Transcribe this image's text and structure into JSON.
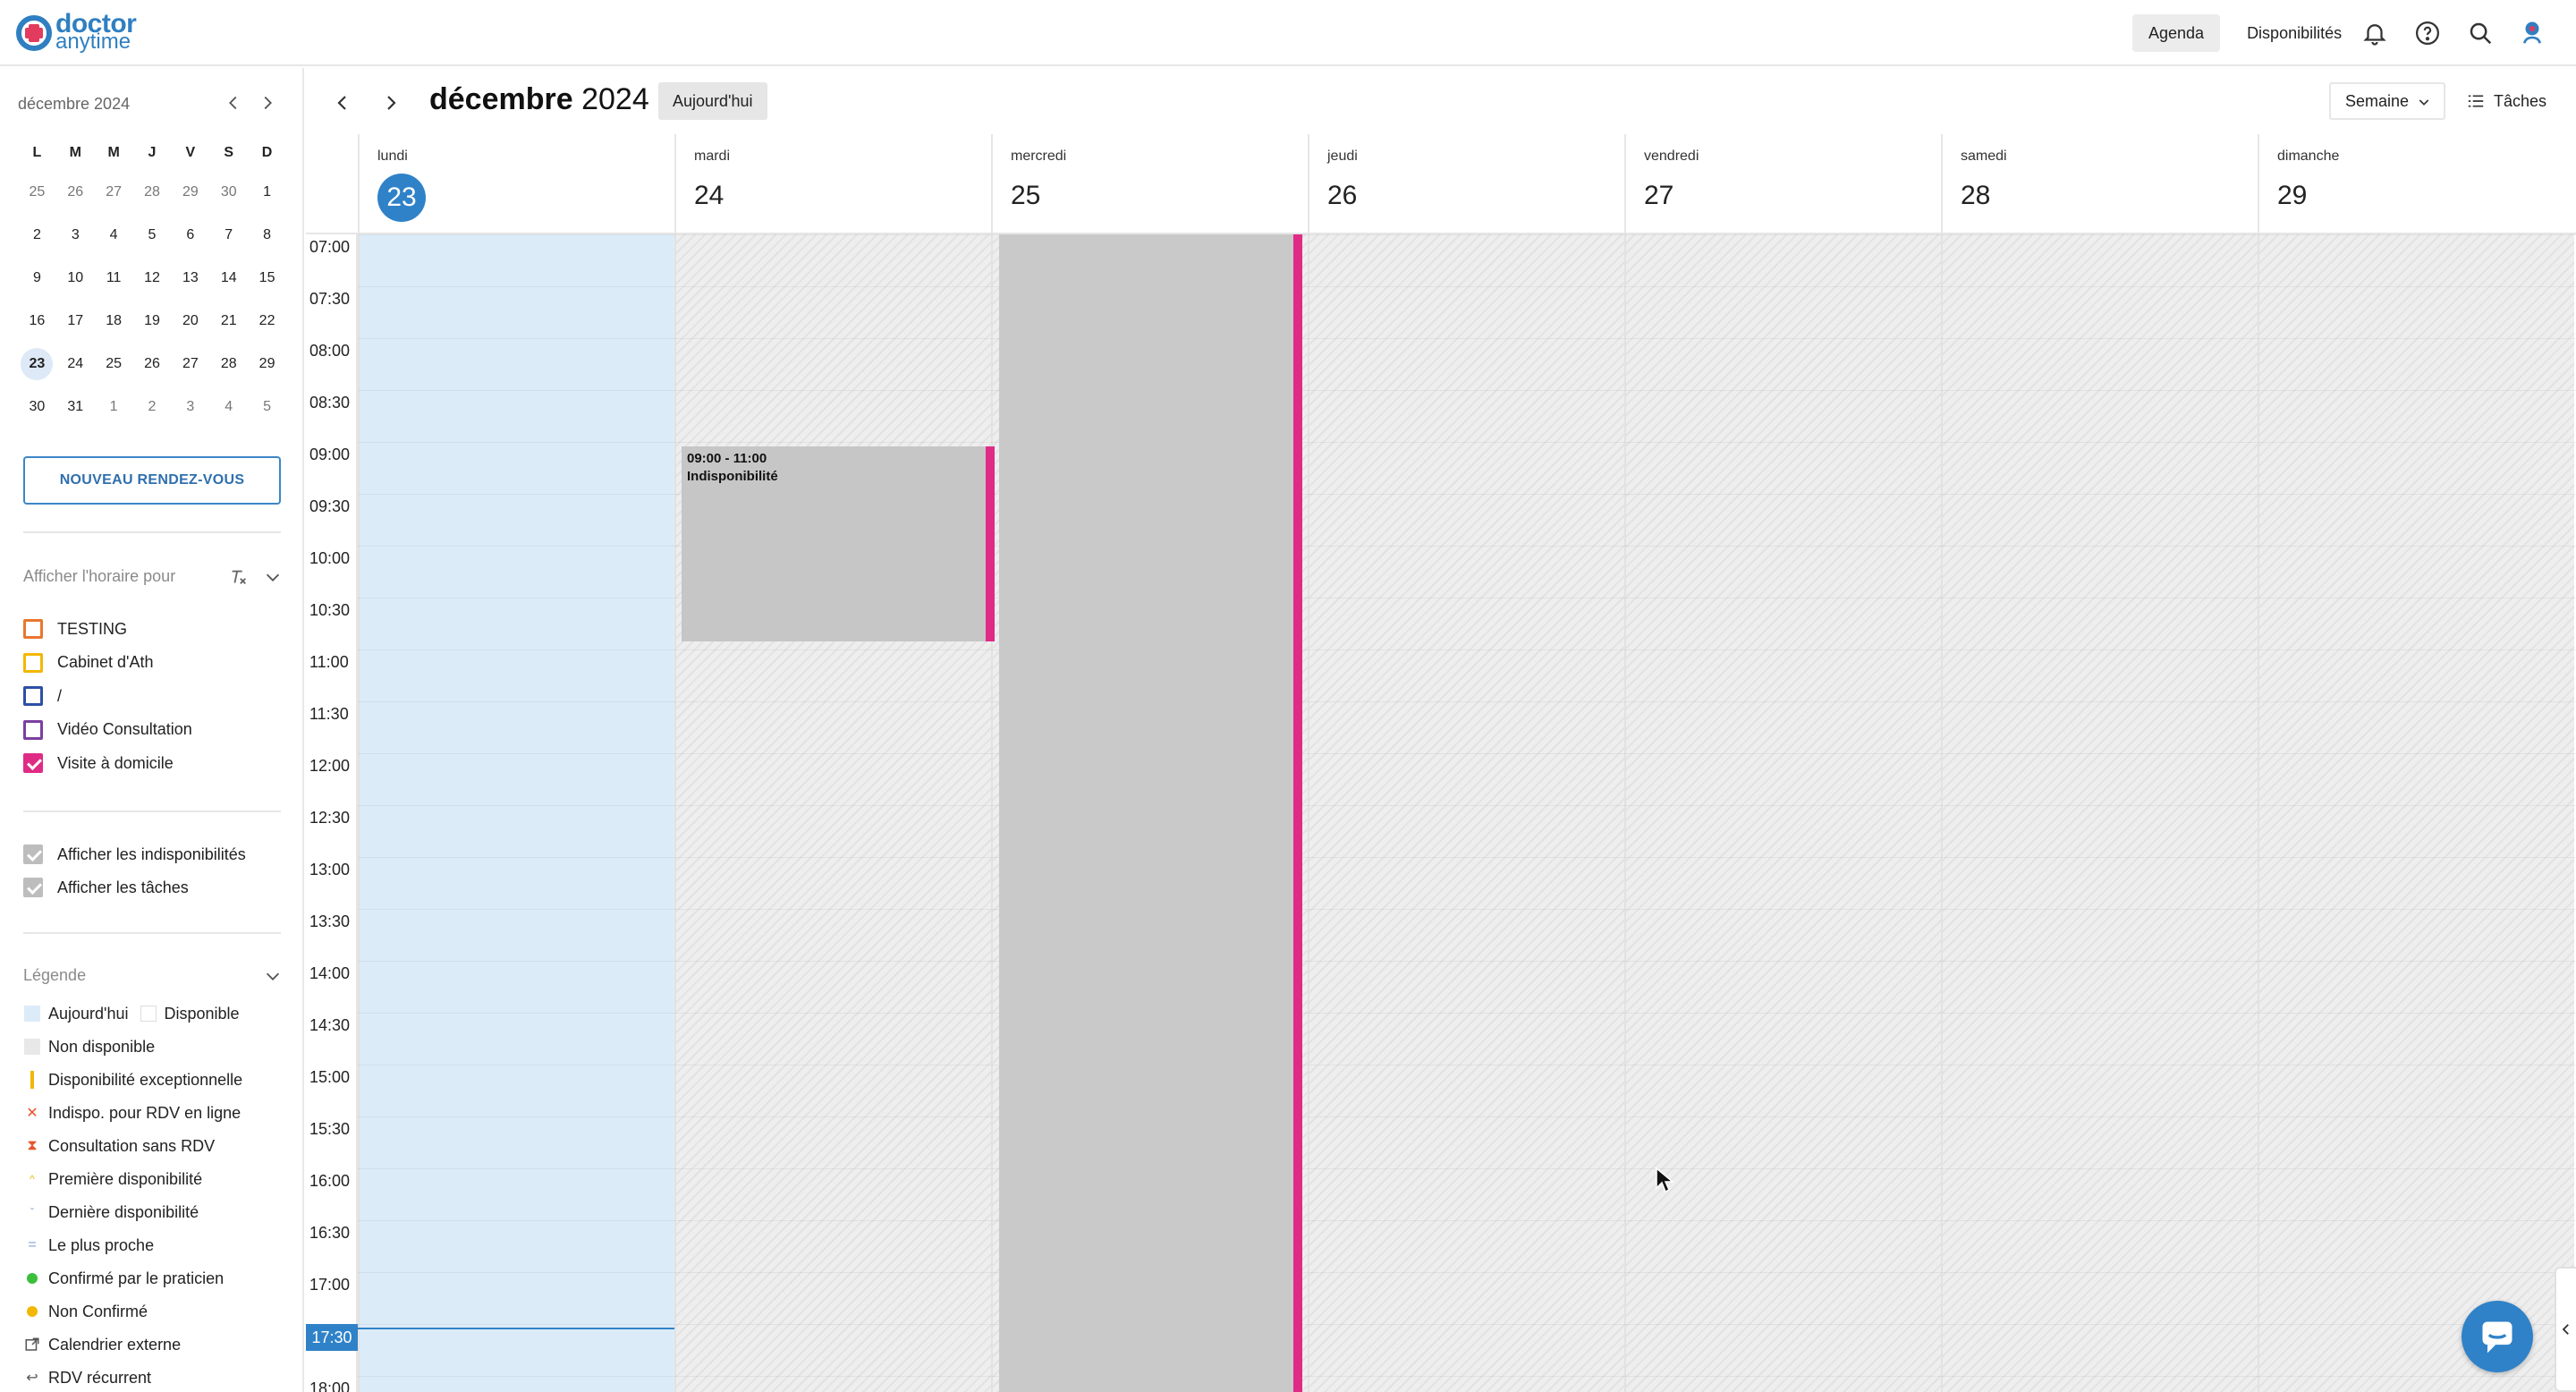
{
  "brand": {
    "line1": "doctor",
    "line2": "anytime"
  },
  "topnav": {
    "agenda": "Agenda",
    "availability": "Disponibilités"
  },
  "icons": {
    "bell": "bell-icon",
    "help": "help-icon",
    "search": "search-icon",
    "profile": "profile-icon",
    "prev": "chevron-left-icon",
    "next": "chevron-right-icon",
    "chat": "chat-icon"
  },
  "mini_calendar": {
    "month_label": "décembre 2024",
    "weekdays": [
      "L",
      "M",
      "M",
      "J",
      "V",
      "S",
      "D"
    ],
    "weeks": [
      [
        "25",
        "26",
        "27",
        "28",
        "29",
        "30",
        "1"
      ],
      [
        "2",
        "3",
        "4",
        "5",
        "6",
        "7",
        "8"
      ],
      [
        "9",
        "10",
        "11",
        "12",
        "13",
        "14",
        "15"
      ],
      [
        "16",
        "17",
        "18",
        "19",
        "20",
        "21",
        "22"
      ],
      [
        "23",
        "24",
        "25",
        "26",
        "27",
        "28",
        "29"
      ],
      [
        "30",
        "31",
        "1",
        "2",
        "3",
        "4",
        "5"
      ]
    ],
    "today": "23"
  },
  "new_appointment_label": "NOUVEAU RENDEZ-VOUS",
  "schedule_filter": {
    "title": "Afficher l'horaire pour",
    "items": [
      {
        "label": "TESTING",
        "color": "#e8772e",
        "checked": false
      },
      {
        "label": "Cabinet d'Ath",
        "color": "#f2b705",
        "checked": false
      },
      {
        "label": "/",
        "color": "#2d4fa8",
        "checked": false
      },
      {
        "label": "Vidéo Consultation",
        "color": "#7b3fa1",
        "checked": false
      },
      {
        "label": "Visite à domicile",
        "color": "#e02b86",
        "checked": true
      }
    ]
  },
  "display_options": [
    {
      "label": "Afficher les indisponibilités",
      "checked": true
    },
    {
      "label": "Afficher les tâches",
      "checked": true
    }
  ],
  "legend": {
    "title": "Légende",
    "today": "Aujourd'hui",
    "available": "Disponible",
    "unavailable": "Non disponible",
    "exceptional": "Disponibilité exceptionnelle",
    "online_unavail": "Indispo. pour RDV en ligne",
    "walkin": "Consultation sans RDV",
    "first": "Première disponibilité",
    "last": "Dernière disponibilité",
    "closest": "Le plus proche",
    "confirmed": "Confirmé par le praticien",
    "unconfirmed": "Non Confirmé",
    "external": "Calendrier externe",
    "recurring": "RDV récurrent"
  },
  "calendar": {
    "month": "décembre",
    "year": "2024",
    "today_button": "Aujourd'hui",
    "view": "Semaine",
    "tasks": "Tâches",
    "days": [
      {
        "name": "lundi",
        "num": "23"
      },
      {
        "name": "mardi",
        "num": "24"
      },
      {
        "name": "mercredi",
        "num": "25"
      },
      {
        "name": "jeudi",
        "num": "26"
      },
      {
        "name": "vendredi",
        "num": "27"
      },
      {
        "name": "samedi",
        "num": "28"
      },
      {
        "name": "dimanche",
        "num": "29"
      }
    ],
    "times": [
      "07:00",
      "07:30",
      "08:00",
      "08:30",
      "09:00",
      "09:30",
      "10:00",
      "10:30",
      "11:00",
      "11:30",
      "12:00",
      "12:30",
      "13:00",
      "13:30",
      "14:00",
      "14:30",
      "15:00",
      "15:30",
      "16:00",
      "16:30",
      "17:00",
      "17:30",
      "18:00"
    ],
    "now_time": "17:30",
    "event": {
      "time": "09:00 - 11:00",
      "title": "Indisponibilité",
      "color": "#e02b86"
    }
  }
}
